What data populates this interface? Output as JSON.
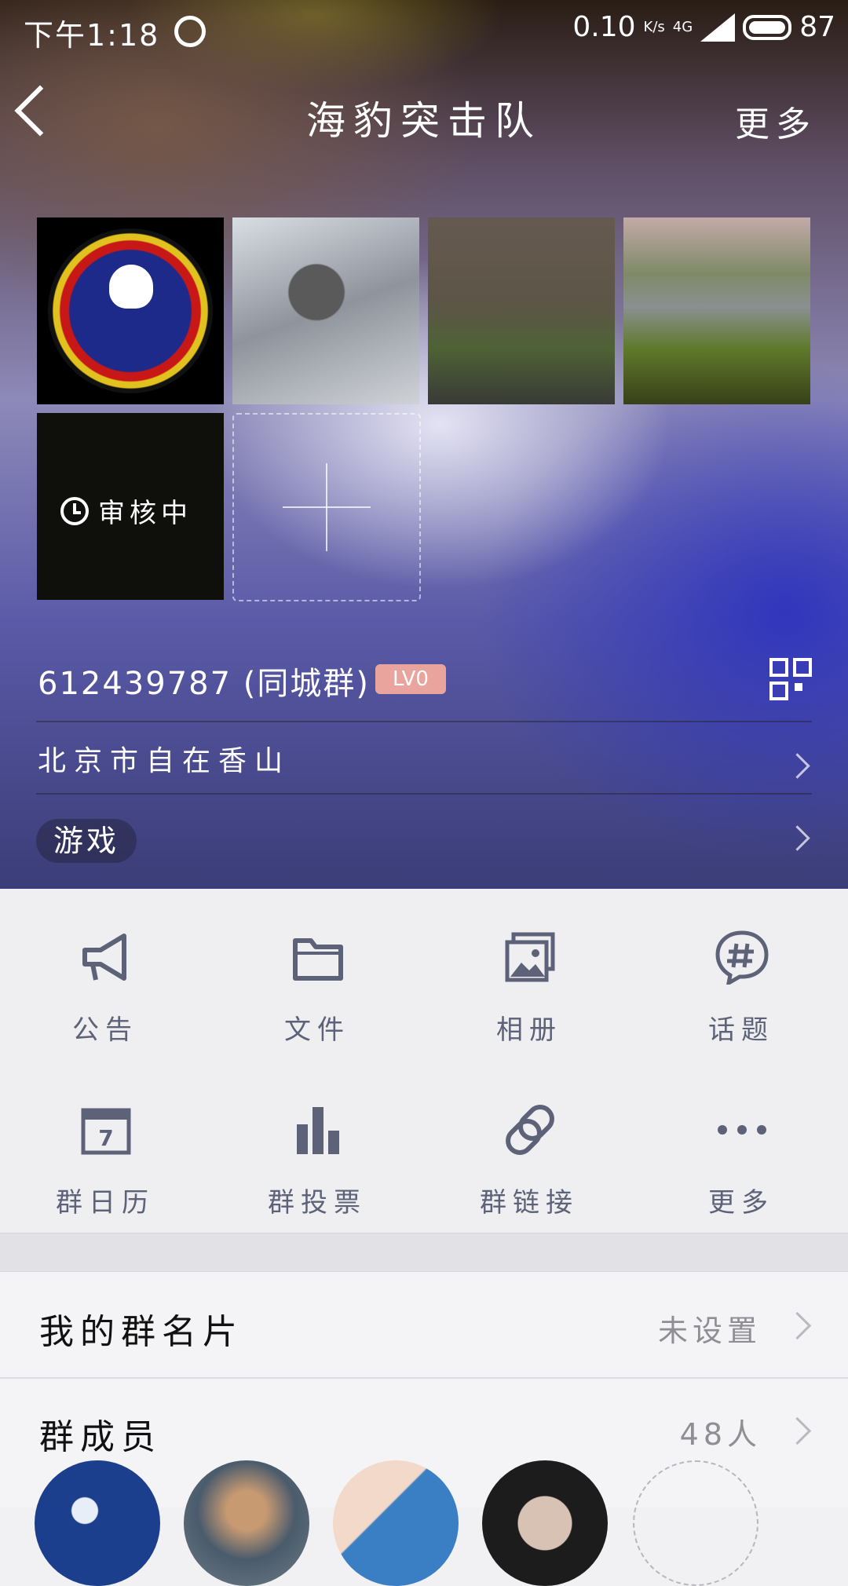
{
  "status_bar": {
    "time": "下午1:18",
    "speed": "0.10",
    "speed_unit": "K/s",
    "network": "4G",
    "battery": "87"
  },
  "nav": {
    "title": "海豹突击队",
    "more": "更多"
  },
  "photos": {
    "pending_label": "审核中"
  },
  "group": {
    "id": "612439787 (同城群)",
    "level": "LV0",
    "location": "北京市自在香山",
    "category": "游戏"
  },
  "functions": [
    {
      "label": "公告",
      "icon": "megaphone-icon"
    },
    {
      "label": "文件",
      "icon": "folder-icon"
    },
    {
      "label": "相册",
      "icon": "photo-album-icon"
    },
    {
      "label": "话题",
      "icon": "topic-hash-icon"
    },
    {
      "label": "群日历",
      "icon": "calendar-icon"
    },
    {
      "label": "群投票",
      "icon": "bar-chart-icon"
    },
    {
      "label": "群链接",
      "icon": "link-icon"
    },
    {
      "label": "更多",
      "icon": "more-dots-icon"
    }
  ],
  "calendar_day": "7",
  "my_card": {
    "title": "我的群名片",
    "value": "未设置"
  },
  "members": {
    "title": "群成员",
    "count": "48人"
  },
  "colors": {
    "accent_icon": "#5d6278",
    "badge": "#e9a59d",
    "panel_bg": "#efeff2"
  }
}
